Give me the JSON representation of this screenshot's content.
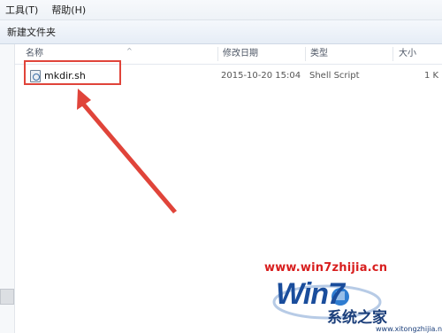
{
  "menu": {
    "items": [
      "工具(T)",
      "帮助(H)"
    ]
  },
  "toolbar": {
    "new_folder": "新建文件夹"
  },
  "columns": {
    "name": "名称",
    "modified": "修改日期",
    "type": "类型",
    "size": "大小"
  },
  "file": {
    "name": "mkdir.sh",
    "modified": "2015-10-20 15:04",
    "type": "Shell Script",
    "size": "1 K"
  },
  "watermark": {
    "url": "www.win7zhijia.cn",
    "logo": "Win7",
    "brand": "系统之家",
    "sub": "www.xitongzhijia.net"
  },
  "colors": {
    "highlight": "#e0443a",
    "arrow": "#e0443a",
    "watermark_red": "#d81e1e",
    "logo_blue": "#1a4d9c"
  },
  "icons": {
    "file": "shell-script-file-icon",
    "sort": "sort-ascending-icon"
  }
}
